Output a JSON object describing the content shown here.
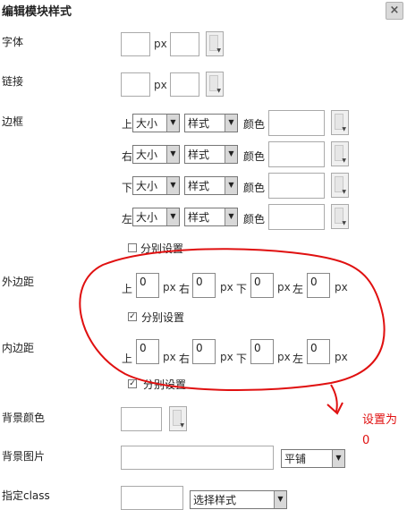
{
  "dialog": {
    "title": "编辑模块样式",
    "close_label": "×"
  },
  "font": {
    "label": "字体",
    "unit": "px"
  },
  "link": {
    "label": "链接",
    "unit": "px"
  },
  "border": {
    "label": "边框",
    "rows": [
      {
        "side": "上",
        "size": "大小",
        "style": "样式",
        "color_label": "颜色"
      },
      {
        "side": "右",
        "size": "大小",
        "style": "样式",
        "color_label": "颜色"
      },
      {
        "side": "下",
        "size": "大小",
        "style": "样式",
        "color_label": "颜色"
      },
      {
        "side": "左",
        "size": "大小",
        "style": "样式",
        "color_label": "颜色"
      }
    ],
    "separate_label": "分别设置",
    "separate_checked": false
  },
  "margin": {
    "label": "外边距",
    "fields": [
      {
        "side": "上",
        "value": "0",
        "unit": "px"
      },
      {
        "side": "右",
        "value": "0",
        "unit": "px"
      },
      {
        "side": "下",
        "value": "0",
        "unit": "px"
      },
      {
        "side": "左",
        "value": "0",
        "unit": "px"
      }
    ],
    "separate_label": "分别设置",
    "separate_checked": true
  },
  "padding": {
    "label": "内边距",
    "fields": [
      {
        "side": "上",
        "value": "0",
        "unit": "px"
      },
      {
        "side": "右",
        "value": "0",
        "unit": "px"
      },
      {
        "side": "下",
        "value": "0",
        "unit": "px"
      },
      {
        "side": "左",
        "value": "0",
        "unit": "px"
      }
    ],
    "separate_label": "分别设置",
    "separate_checked": true
  },
  "bg_color": {
    "label": "背景颜色"
  },
  "bg_image": {
    "label": "背景图片",
    "repeat": "平铺"
  },
  "css_class": {
    "label": "指定class",
    "select": "选择样式"
  },
  "annotation": {
    "text_line1": "设置为",
    "text_line2": "0",
    "color": "#e01010"
  },
  "icons": {
    "checkbox_mark": "✓",
    "dropdown_arrow": "▼",
    "close_icon": "close-icon"
  }
}
